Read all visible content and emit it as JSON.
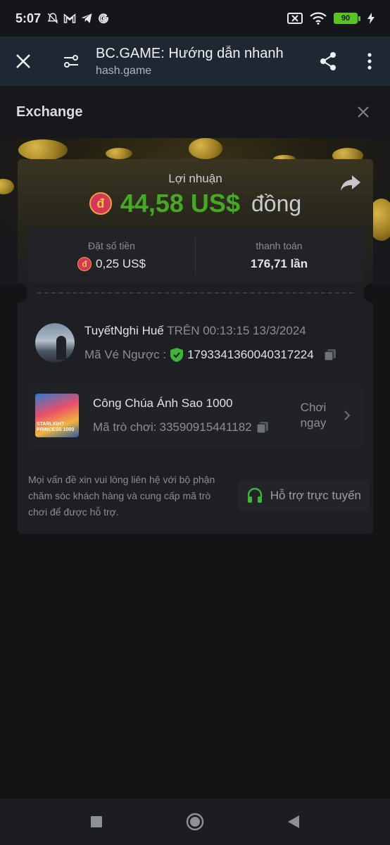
{
  "status_bar": {
    "time": "5:07",
    "battery": "90",
    "icons": [
      "bell-off-icon",
      "gmail-icon",
      "telegram-icon",
      "google-icon"
    ]
  },
  "browser": {
    "title": "BC.GAME: Hướng dẫn nhanh",
    "url": "hash.game"
  },
  "exchange": {
    "title": "Exchange"
  },
  "ticket": {
    "profit_label": "Lợi nhuận",
    "currency_symbol": "đ",
    "profit_amount": "44,58 US$",
    "profit_unit": "đồng",
    "bet_label": "Đặt số tiền",
    "bet_value": "0,25 US$",
    "payout_label": "thanh toán",
    "payout_value": "176,71 lần"
  },
  "user": {
    "name": "TuyếtNghi Huế",
    "on_label": "TRÊN",
    "datetime": "00:13:15 13/3/2024",
    "ticket_label": "Mã Vé Ngược :",
    "ticket_id": "1793341360040317224"
  },
  "game": {
    "name": "Công Chúa Ánh Sao 1000",
    "code_label": "Mã trò chơi:",
    "code": "33590915441182",
    "play_line1": "Chơi",
    "play_line2": "ngay",
    "thumb_text": "STARLIGHT PRINCESS 1000"
  },
  "support": {
    "text": "Mọi vấn đề xin vui lòng liên hệ với bộ phận chăm sóc khách hàng và cung cấp mã trò chơi để được hỗ trợ.",
    "button": "Hỗ trợ trực tuyến"
  },
  "colors": {
    "profit_green": "#45a926",
    "badge_red": "#d5365a",
    "shield_green": "#3fb33a",
    "support_green": "#3fb33a"
  }
}
